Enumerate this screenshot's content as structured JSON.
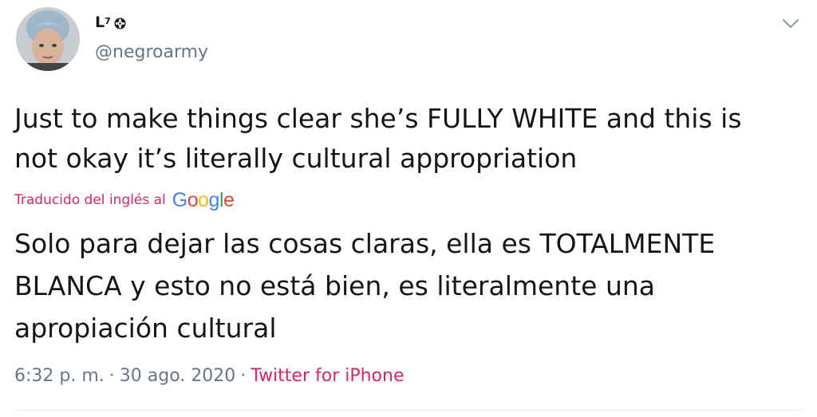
{
  "author": {
    "display_name": "L",
    "display_name_superscript": "7",
    "badge_icon": "flower-icon",
    "username": "@negroarmy"
  },
  "menu": {
    "icon": "chevron-down-icon"
  },
  "tweet": {
    "text_line_1": "Just to make things clear she’s FULLY WHITE and this is",
    "text_line_2": "not okay it’s literally cultural appropriation"
  },
  "translation": {
    "label": "Traducido del inglés al",
    "provider_letters": [
      "G",
      "o",
      "o",
      "g",
      "l",
      "e"
    ],
    "text_line_1": "Solo para dejar las cosas claras, ella es TOTALMENTE",
    "text_line_2": "BLANCA y esto no está bien, es literalmente una",
    "text_line_3": "apropiación cultural"
  },
  "meta": {
    "time": "6:32 p. m.",
    "separator": "·",
    "date": "30 ago. 2020",
    "source": "Twitter for iPhone"
  },
  "colors": {
    "accent": "#e0245e",
    "secondary_text": "#657786",
    "primary_text": "#14171a",
    "google_blue": "#4285f4",
    "google_red": "#ea4335",
    "google_yellow": "#fbbc05",
    "google_green": "#34a853"
  }
}
